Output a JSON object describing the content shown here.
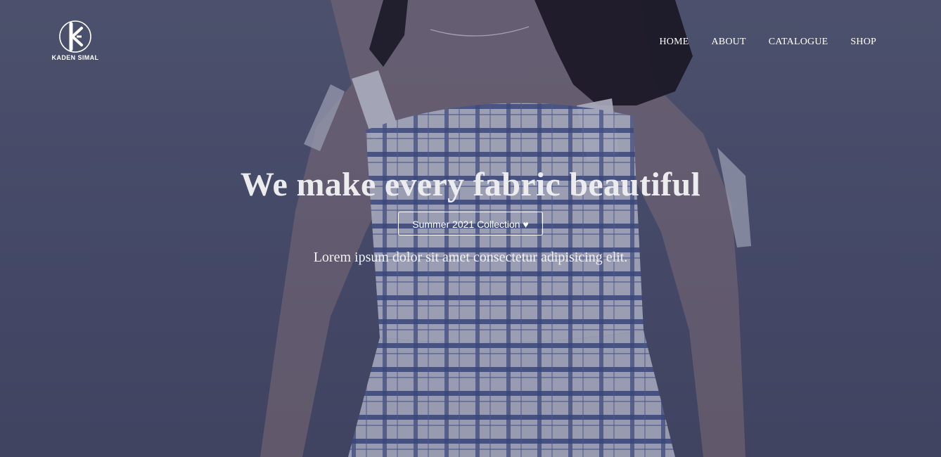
{
  "brand": {
    "name": "KADEN SIMAL",
    "logo_icon": "k-monogram-circle-icon"
  },
  "nav": {
    "items": [
      {
        "label": "HOME"
      },
      {
        "label": "ABOUT"
      },
      {
        "label": "CATALOGUE"
      },
      {
        "label": "SHOP"
      }
    ]
  },
  "hero": {
    "title": "We make every fabric beautiful",
    "button_label": "Summer 2021 Collection ♥",
    "subtitle": "Lorem ipsum dolor sit amet consectetur adipisicing elit.",
    "background_image": "woman-in-blue-white-plaid-dress"
  },
  "colors": {
    "overlay": "#4a4d66",
    "text": "#ffffff",
    "dress_stripe": "#2e3f7a"
  }
}
